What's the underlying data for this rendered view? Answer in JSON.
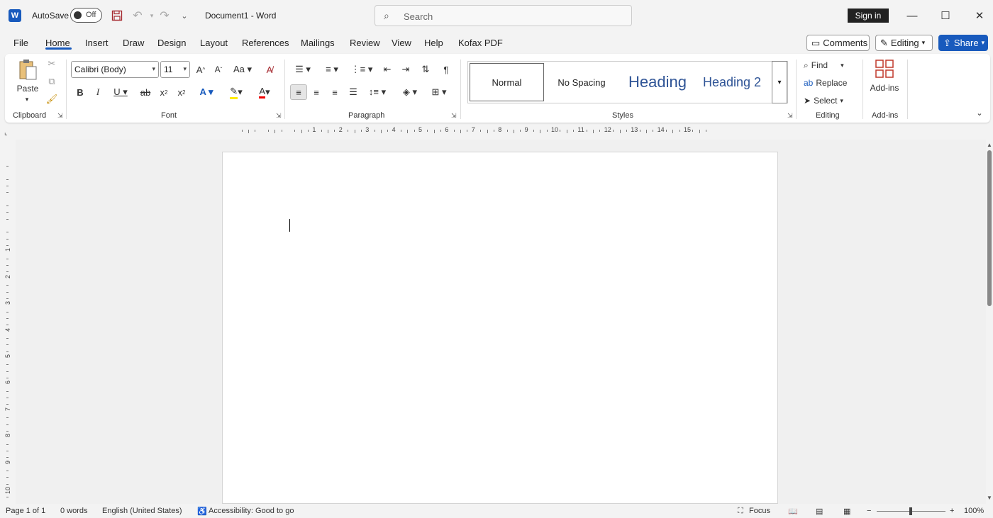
{
  "titlebar": {
    "app_badge": "W",
    "autosave_label": "AutoSave",
    "autosave_state": "Off",
    "doc_title": "Document1  -  Word",
    "search_placeholder": "Search",
    "signin_label": "Sign in"
  },
  "menu": {
    "tabs": [
      "File",
      "Home",
      "Insert",
      "Draw",
      "Design",
      "Layout",
      "References",
      "Mailings",
      "Review",
      "View",
      "Help",
      "Kofax PDF"
    ],
    "active_tab": "Home",
    "comments_label": "Comments",
    "editing_label": "Editing",
    "share_label": "Share"
  },
  "ribbon": {
    "clipboard": {
      "paste_label": "Paste",
      "group_label": "Clipboard"
    },
    "font": {
      "font_name": "Calibri (Body)",
      "font_size": "11",
      "group_label": "Font"
    },
    "paragraph": {
      "group_label": "Paragraph"
    },
    "styles": {
      "normal": "Normal",
      "no_spacing": "No Spacing",
      "heading": "Heading",
      "heading2": "Heading 2",
      "group_label": "Styles"
    },
    "editing": {
      "find_label": "Find",
      "replace_label": "Replace",
      "select_label": "Select",
      "group_label": "Editing"
    },
    "addins": {
      "button_label": "Add-ins",
      "group_label": "Add-ins"
    }
  },
  "ruler": {
    "h_numbers": [
      "1",
      "2",
      "3",
      "4",
      "5",
      "6",
      "7",
      "8",
      "9",
      "10",
      "11",
      "12",
      "13",
      "14",
      "15"
    ],
    "v_numbers": [
      "1",
      "2",
      "3",
      "4",
      "5",
      "6",
      "7",
      "8",
      "9",
      "10"
    ]
  },
  "status": {
    "page": "Page 1 of 1",
    "words": "0 words",
    "language": "English (United States)",
    "accessibility": "Accessibility: Good to go",
    "focus_label": "Focus",
    "zoom": "100%"
  },
  "colors": {
    "accent": "#185abd",
    "heading": "#2f5496"
  }
}
